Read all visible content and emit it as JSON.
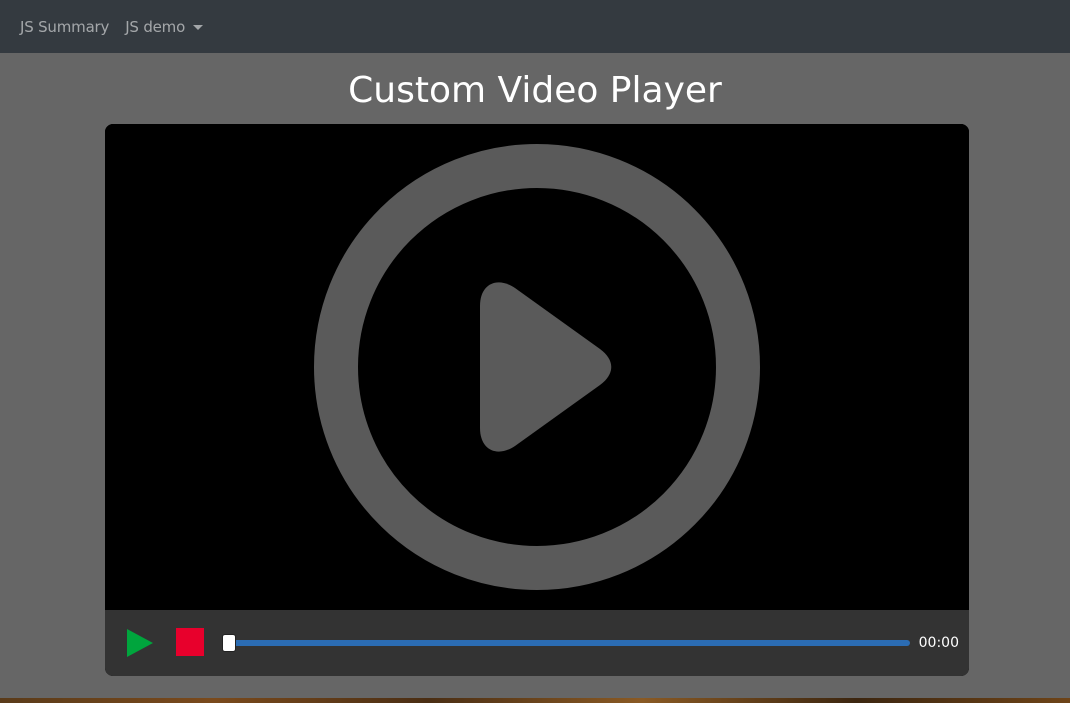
{
  "nav": {
    "items": [
      {
        "label": "JS Summary",
        "has_dropdown": false
      },
      {
        "label": "JS demo",
        "has_dropdown": true
      }
    ]
  },
  "page": {
    "title": "Custom Video Player"
  },
  "player": {
    "poster_icon": "play-circle-icon",
    "controls": {
      "play_icon": "play-icon",
      "stop_icon": "stop-icon",
      "progress_fraction": 0,
      "timestamp": "00:00"
    }
  },
  "colors": {
    "navbar_bg": "#343a40",
    "page_bg": "#666666",
    "controls_bg": "#333333",
    "play_green": "#00a53d",
    "stop_red": "#e8002c",
    "progress_blue": "#2b6cb3",
    "poster_gray": "#5a5a5a"
  }
}
